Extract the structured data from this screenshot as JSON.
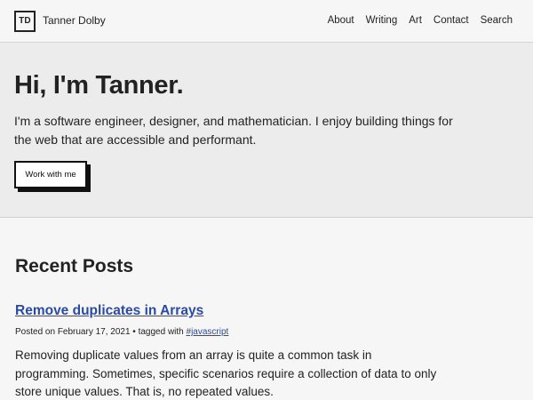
{
  "header": {
    "logo_text": "TD",
    "site_name": "Tanner Dolby",
    "nav": [
      "About",
      "Writing",
      "Art",
      "Contact",
      "Search"
    ]
  },
  "hero": {
    "title": "Hi, I'm Tanner.",
    "intro": "I'm a software engineer, designer, and mathematician. I enjoy building things for the web that are accessible and performant.",
    "cta_label": "Work with me"
  },
  "recent_posts": {
    "heading": "Recent Posts",
    "posts": [
      {
        "title": "Remove duplicates in Arrays",
        "meta_prefix": "Posted on February 17, 2021 • tagged with ",
        "tag": "#javascript",
        "excerpt": "Removing duplicate values from an array is quite a common task in programming. Sometimes, specific scenarios require a collection of data to only store unique values. That is, no repeated values."
      }
    ]
  },
  "colors": {
    "link": "#2a4aa8",
    "header_bg": "#f6f6f6",
    "hero_bg": "#ececec",
    "text": "#222222"
  }
}
